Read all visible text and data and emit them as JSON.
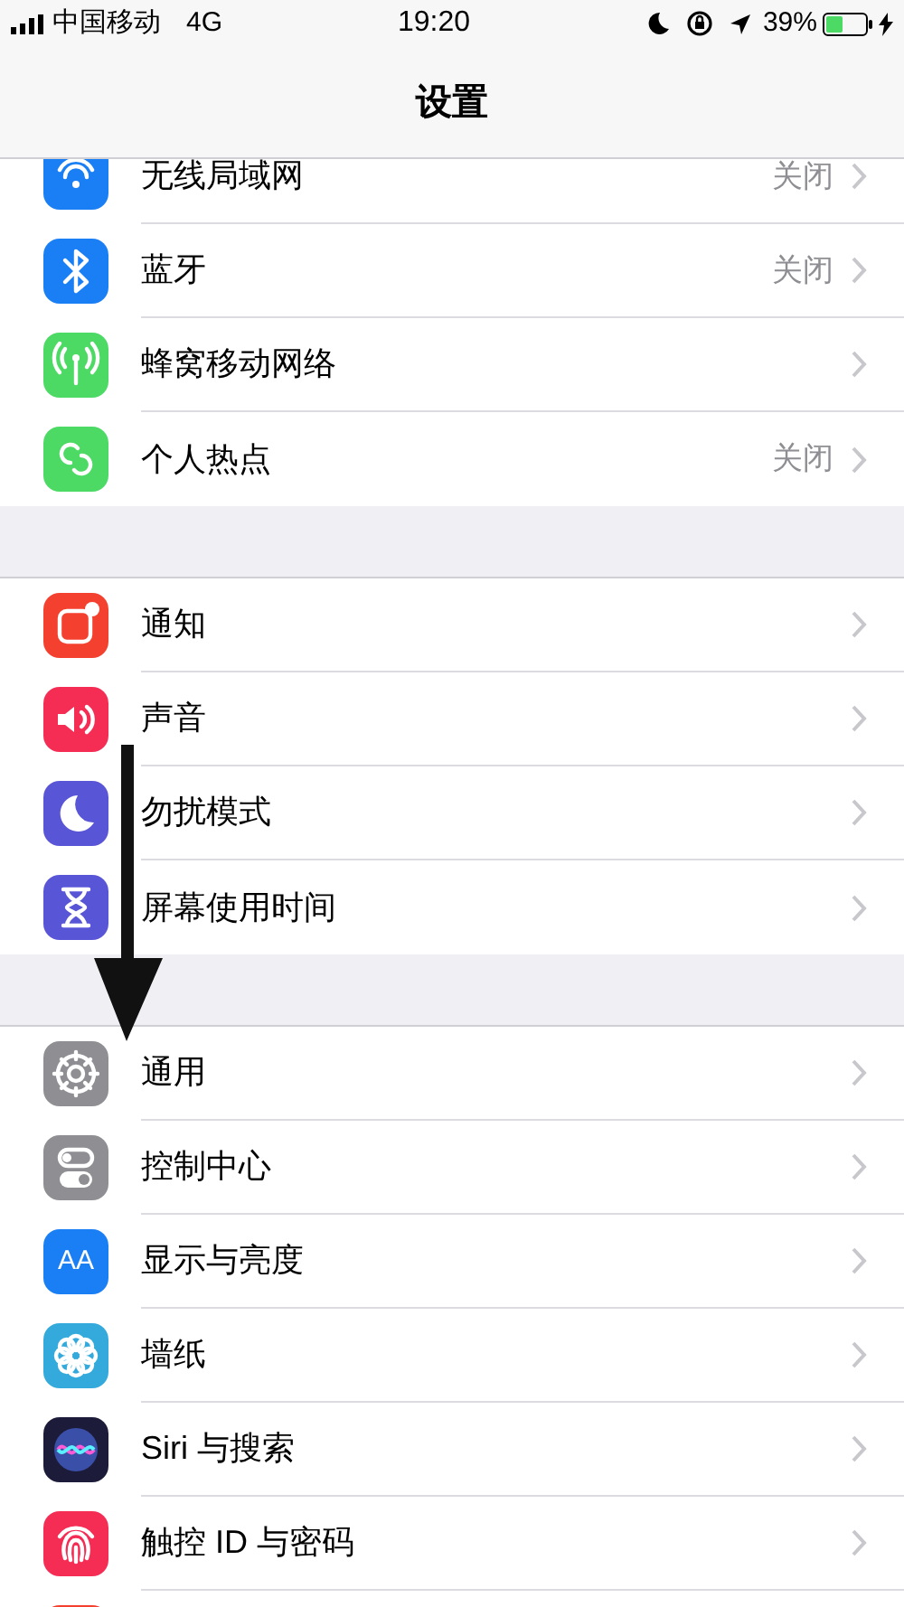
{
  "status_bar": {
    "carrier": "中国移动",
    "network": "4G",
    "time": "19:20",
    "battery": "39%"
  },
  "nav": {
    "title": "设置"
  },
  "groups": [
    {
      "items": [
        {
          "label": "无线局域网",
          "value": "关闭",
          "kind": "wifi",
          "color": "#1a7ff5"
        },
        {
          "label": "蓝牙",
          "value": "关闭",
          "kind": "bluetooth",
          "color": "#1a7ff5"
        },
        {
          "label": "蜂窝移动网络",
          "kind": "antenna",
          "color": "#4cd964"
        },
        {
          "label": "个人热点",
          "value": "关闭",
          "kind": "link",
          "color": "#4cd964"
        }
      ]
    },
    {
      "items": [
        {
          "label": "通知",
          "kind": "notify",
          "color": "#f4402f"
        },
        {
          "label": "声音",
          "kind": "speaker",
          "color": "#f52d55"
        },
        {
          "label": "勿扰模式",
          "kind": "moon",
          "color": "#5856d6"
        },
        {
          "label": "屏幕使用时间",
          "kind": "hourglass",
          "color": "#5856d6"
        }
      ]
    },
    {
      "items": [
        {
          "label": "通用",
          "kind": "gear",
          "color": "#8e8e93"
        },
        {
          "label": "控制中心",
          "kind": "toggles",
          "color": "#8e8e93"
        },
        {
          "label": "显示与亮度",
          "kind": "text",
          "icon_text": "AA",
          "color": "#1a7ff5"
        },
        {
          "label": "墙纸",
          "kind": "flower",
          "color": "#34aadc"
        },
        {
          "label": "Siri 与搜索",
          "kind": "siri",
          "color": "#1c1c3a"
        },
        {
          "label": "触控 ID 与密码",
          "kind": "fingerprint",
          "color": "#f52d55"
        },
        {
          "kind": "blank",
          "color": "#f4402f"
        }
      ]
    }
  ]
}
